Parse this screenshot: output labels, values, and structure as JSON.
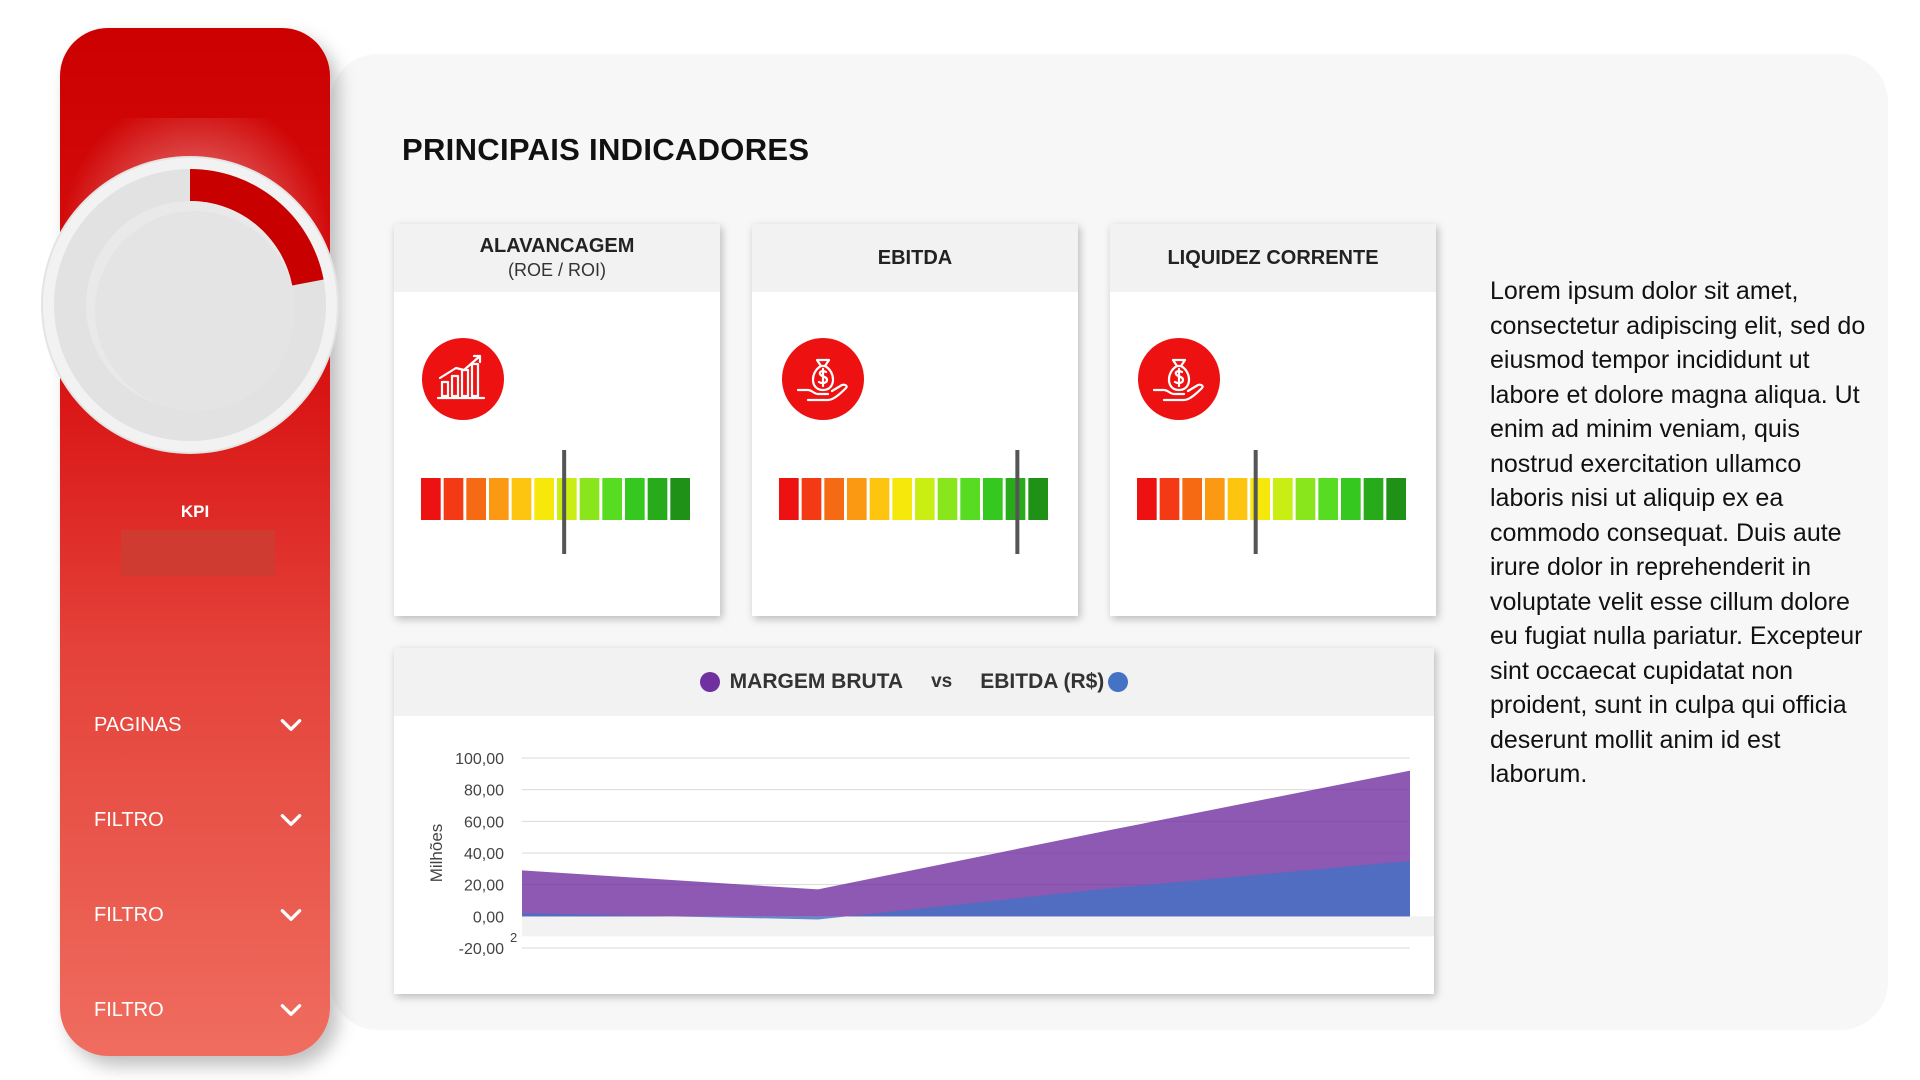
{
  "page_title": "PRINCIPAIS INDICADORES",
  "sidebar": {
    "dial_fraction": 0.22,
    "kpi_label": "KPI",
    "nav": [
      {
        "label": "PAGINAS",
        "icon": "chevron-down-icon"
      },
      {
        "label": "FILTRO",
        "icon": "chevron-down-icon"
      },
      {
        "label": "FILTRO",
        "icon": "chevron-down-icon"
      },
      {
        "label": "FILTRO",
        "icon": "chevron-down-icon"
      }
    ]
  },
  "cards": [
    {
      "title": "ALAVANCAGEM",
      "subtitle": "(ROE / ROI)",
      "icon": "growth-chart-icon",
      "gauge_fraction": 0.53
    },
    {
      "title": "EBITDA",
      "subtitle": "",
      "icon": "money-bag-hand-icon",
      "gauge_fraction": 0.88
    },
    {
      "title": "LIQUIDEZ CORRENTE",
      "subtitle": "",
      "icon": "money-bag-hand-icon",
      "gauge_fraction": 0.44
    }
  ],
  "chart": {
    "legend_a": "MARGEM BRUTA",
    "vs": "vs",
    "legend_b": "EBITDA (R$)",
    "colors": {
      "a": "#7030a0",
      "b": "#4472c4"
    }
  },
  "chart_data": {
    "type": "area",
    "title": "MARGEM BRUTA vs EBITDA (R$)",
    "ylabel": "Milhões",
    "ylim": [
      -20,
      100
    ],
    "yticks": [
      "100,00",
      "80,00",
      "60,00",
      "40,00",
      "20,00",
      "0,00",
      "-20,00"
    ],
    "x": [
      1,
      2,
      3,
      4
    ],
    "x_tick_label": "2",
    "series": [
      {
        "name": "MARGEM BRUTA",
        "values": [
          29,
          17,
          55,
          92
        ],
        "color": "#7030a0"
      },
      {
        "name": "EBITDA (R$)",
        "values": [
          2,
          -2,
          18,
          35
        ],
        "color": "#4472c4"
      }
    ],
    "grid": true
  },
  "lorem": "Lorem ipsum dolor sit amet, consectetur adipiscing elit, sed do eiusmod tempor incididunt ut labore et dolore magna aliqua. Ut enim ad minim veniam, quis nostrud exercitation ullamco laboris nisi ut aliquip ex ea commodo consequat. Duis aute irure dolor in reprehenderit in voluptate velit esse cillum dolore eu fugiat nulla pariatur. Excepteur sint occaecat cupidatat non proident, sunt in culpa qui officia deserunt mollit anim id est laborum."
}
